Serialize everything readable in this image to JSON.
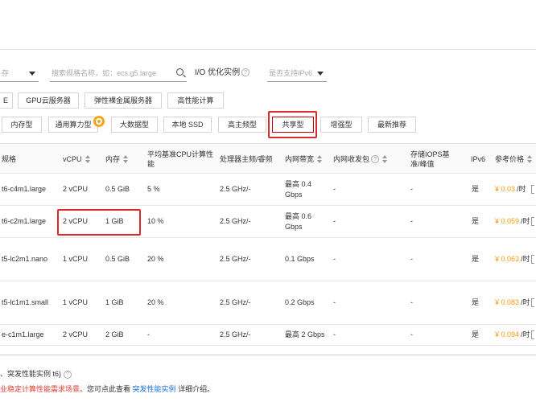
{
  "filters": {
    "family_select_value": "存",
    "search_placeholder": "搜索规格名称，如：ecs.g5.large",
    "io_label": "I/O 优化实例",
    "ipv6_select_value": "是否支持IPv6"
  },
  "categories_row1": [
    "E",
    "GPU云服务器",
    "弹性裸金属服务器",
    "高性能计算"
  ],
  "categories_row2": [
    "内存型",
    "通用算力型",
    "大数据型",
    "本地 SSD",
    "高主频型",
    "共享型",
    "增强型",
    "最新推荐"
  ],
  "table": {
    "headers": {
      "spec": "规格",
      "vcpu": "vCPU",
      "memory": "内存",
      "baseline": "平均基准CPU计算性能",
      "processor": "处理器主频/睿频",
      "bandwidth": "内网带宽",
      "pps": "内网收发包",
      "iops": "存储IOPS基准/峰值",
      "ipv6": "IPv6",
      "price": "参考价格"
    },
    "rows": [
      {
        "spec": "t6-c4m1.large",
        "vcpu": "2 vCPU",
        "memory": "0.5 GiB",
        "baseline": "5 %",
        "processor": "2.5 GHz/-",
        "bandwidth": "最高 0.4 Gbps",
        "pps": "-",
        "iops": "-",
        "ipv6": "是",
        "price": "¥ 0.03",
        "unit": "/时"
      },
      {
        "spec": "t6-c2m1.large",
        "vcpu": "2 vCPU",
        "memory": "1 GiB",
        "baseline": "10 %",
        "processor": "2.5 GHz/-",
        "bandwidth": "最高 0.6 Gbps",
        "pps": "-",
        "iops": "-",
        "ipv6": "是",
        "price": "¥ 0.059",
        "unit": "/时"
      },
      {
        "spec": "t5-lc2m1.nano",
        "vcpu": "1 vCPU",
        "memory": "0.5 GiB",
        "baseline": "20 %",
        "processor": "2.5 GHz/-",
        "bandwidth": "0.1 Gbps",
        "pps": "-",
        "iops": "-",
        "ipv6": "是",
        "price": "¥ 0.063",
        "unit": "/时"
      },
      {
        "spec": "t5-lc1m1.small",
        "vcpu": "1 vCPU",
        "memory": "1 GiB",
        "baseline": "20 %",
        "processor": "2.5 GHz/-",
        "bandwidth": "0.2 Gbps",
        "pps": "-",
        "iops": "-",
        "ipv6": "是",
        "price": "¥ 0.083",
        "unit": "/时"
      },
      {
        "spec": "e-c1m1.large",
        "vcpu": "2 vCPU",
        "memory": "2 GiB",
        "baseline": "-",
        "processor": "2.5 GHz/-",
        "bandwidth": "最高 2 Gbps",
        "pps": "-",
        "iops": "-",
        "ipv6": "是",
        "price": "¥ 0.094",
        "unit": "/时"
      }
    ]
  },
  "footer": {
    "selected_text": "、突发性能实例 t6)",
    "notice_prefix": "业稳定计算性能需求场景。",
    "notice_middle": "您可点此查看",
    "notice_link": "突发性能实例",
    "notice_suffix": "详细介绍。"
  },
  "colors": {
    "highlight": "#d92b2b",
    "price": "#f39c12",
    "link": "#1a73e8",
    "notice": "#e63b2e"
  }
}
